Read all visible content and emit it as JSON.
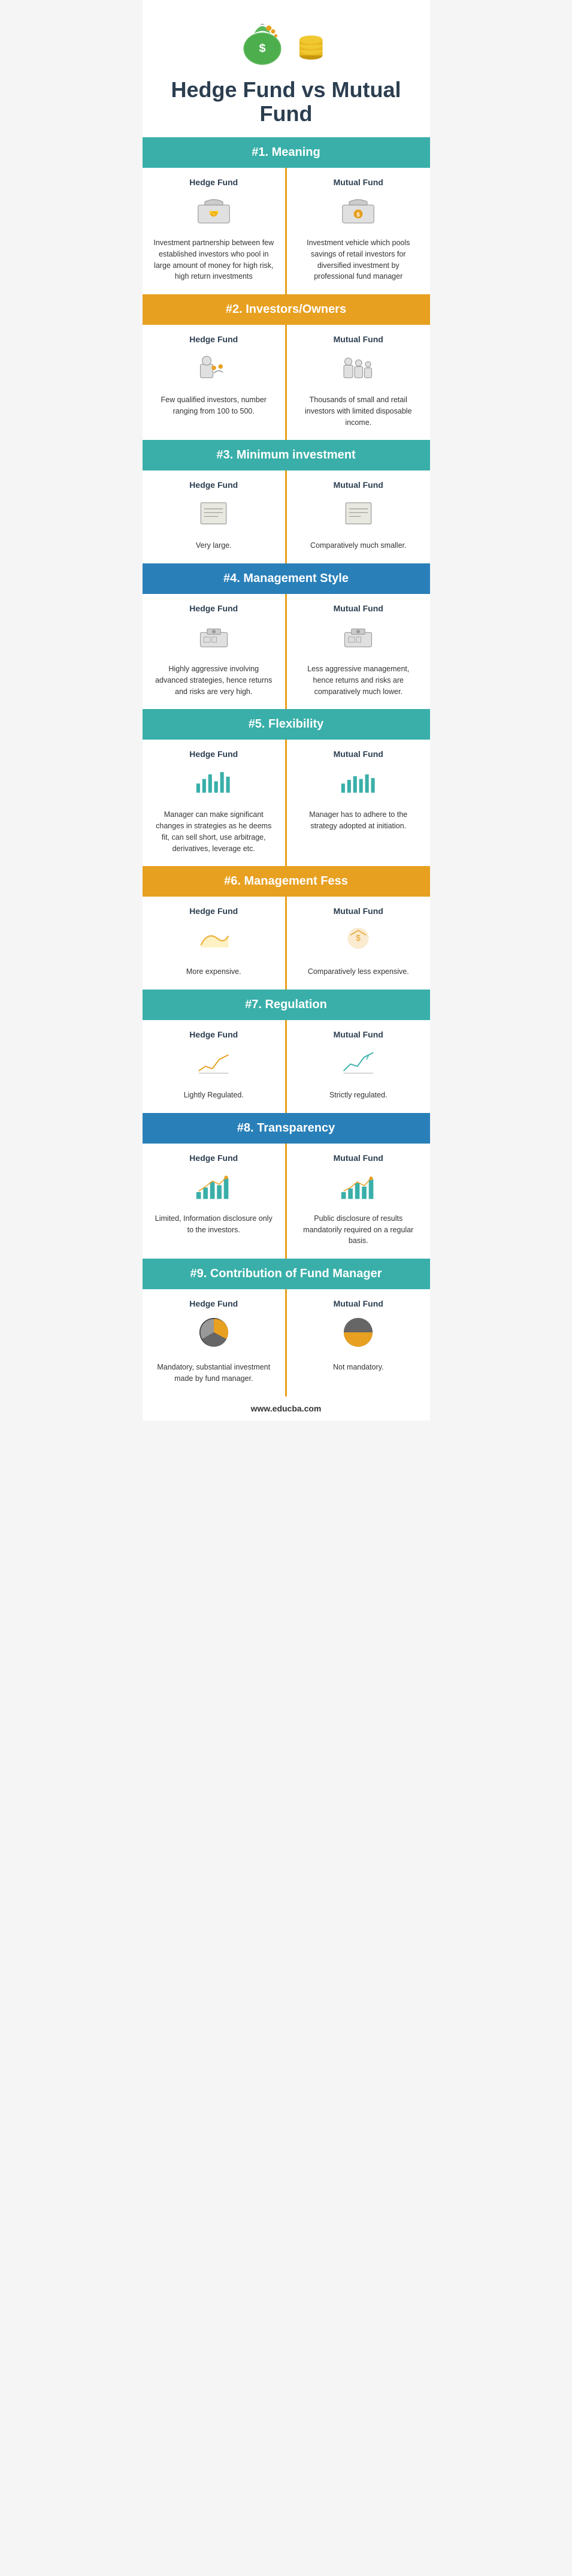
{
  "header": {
    "title": "Hedge Fund vs Mutual Fund",
    "icon_bag": "💰",
    "icon_coins": "🪙"
  },
  "footer": {
    "url": "www.educba.com"
  },
  "sections": [
    {
      "id": "meaning",
      "number": "#1.",
      "label": "Meaning",
      "color": "teal",
      "hedge": {
        "title": "Hedge Fund",
        "text": "Investment partnership between few established investors who pool in large amount of money for high risk, high return investments"
      },
      "mutual": {
        "title": "Mutual Fund",
        "text": "Investment vehicle which pools savings of retail investors for diversified investment by professional fund manager"
      }
    },
    {
      "id": "investors",
      "number": "#2.",
      "label": "Investors/Owners",
      "color": "orange",
      "hedge": {
        "title": "Hedge Fund",
        "text": "Few qualified investors, number ranging from 100 to 500."
      },
      "mutual": {
        "title": "Mutual Fund",
        "text": "Thousands of small and retail investors with limited disposable income."
      }
    },
    {
      "id": "minimum",
      "number": "#3.",
      "label": "Minimum investment",
      "color": "teal",
      "hedge": {
        "title": "Hedge Fund",
        "text": "Very large."
      },
      "mutual": {
        "title": "Mutual Fund",
        "text": "Comparatively much smaller."
      }
    },
    {
      "id": "management-style",
      "number": "#4.",
      "label": "Management Style",
      "color": "blue",
      "hedge": {
        "title": "Hedge Fund",
        "text": "Highly aggressive involving advanced strategies, hence returns and risks are very high."
      },
      "mutual": {
        "title": "Mutual Fund",
        "text": "Less aggressive management, hence returns and risks are comparatively much lower."
      }
    },
    {
      "id": "flexibility",
      "number": "#5.",
      "label": "Flexibility",
      "color": "teal",
      "hedge": {
        "title": "Hedge Fund",
        "text": "Manager can make significant changes in strategies as he deems fit, can sell short, use arbitrage, derivatives, leverage etc."
      },
      "mutual": {
        "title": "Mutual Fund",
        "text": "Manager has to adhere to the strategy adopted at initiation."
      }
    },
    {
      "id": "management-fees",
      "number": "#6.",
      "label": "Management Fess",
      "color": "orange",
      "hedge": {
        "title": "Hedge Fund",
        "text": "More expensive."
      },
      "mutual": {
        "title": "Mutual Fund",
        "text": "Comparatively less expensive."
      }
    },
    {
      "id": "regulation",
      "number": "#7.",
      "label": "Regulation",
      "color": "teal",
      "hedge": {
        "title": "Hedge Fund",
        "text": "Lightly Regulated."
      },
      "mutual": {
        "title": "Mutual Fund",
        "text": "Strictly regulated."
      }
    },
    {
      "id": "transparency",
      "number": "#8.",
      "label": "Transparency",
      "color": "blue",
      "hedge": {
        "title": "Hedge Fund",
        "text": "Limited, Information disclosure only to the investors."
      },
      "mutual": {
        "title": "Mutual Fund",
        "text": "Public disclosure of results mandatorily required on a regular basis."
      }
    },
    {
      "id": "contribution",
      "number": "#9.",
      "label": "Contribution of Fund Manager",
      "color": "teal",
      "hedge": {
        "title": "Hedge Fund",
        "text": "Mandatory, substantial investment made by fund manager."
      },
      "mutual": {
        "title": "Mutual Fund",
        "text": "Not mandatory."
      }
    }
  ]
}
